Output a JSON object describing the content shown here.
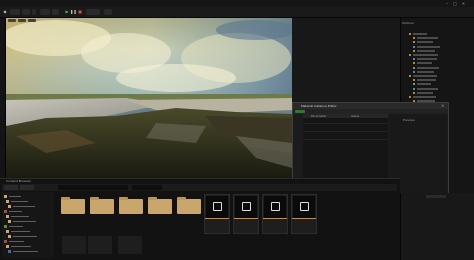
{
  "window": {
    "title": "",
    "controls": [
      "–",
      "□",
      "✕"
    ]
  },
  "toolbar": {
    "buttons": [
      "File",
      "Edit",
      "Window",
      "Tools",
      "Build",
      "Select"
    ],
    "platforms_label": "Platforms",
    "mode_label": "Selection Mode"
  },
  "material_window": {
    "title": "Material Instance Editor",
    "column_headers": [
      "Parameter",
      "Value"
    ],
    "preview_label": "Preview"
  },
  "outliner": {
    "header": "Outliner",
    "row_colors": [
      "#d8b64a",
      "#d8b64a",
      "#d8b64a",
      "#6fa8e0",
      "#d8b64a",
      "#d8b64a",
      "#6fa8e0",
      "#d8b64a",
      "#d8b64a",
      "#6fa8e0",
      "#d8b64a",
      "#d8b64a",
      "#d8b64a",
      "#6fa8e0",
      "#d8b64a",
      "#d8b64a",
      "#d8b64a",
      "#6fa8e0",
      "#d8b64a",
      "#d8b64a",
      "#d8b64a",
      "#d8b64a",
      "#6fa8e0",
      "#d8b64a"
    ]
  },
  "content_browser": {
    "header": "Content Browser",
    "add_label": "Add",
    "import_label": "Import",
    "folders": [
      "",
      "",
      "",
      "",
      ""
    ],
    "assets": [
      "",
      "",
      "",
      ""
    ],
    "status": ""
  },
  "colors": {
    "accent_orange": "#d68a2b",
    "folder": "#c9a66b",
    "play_green": "#4ec24e",
    "stop_red": "#d34a4a",
    "apply_green": "#2d7a2d"
  },
  "icons": {
    "play": "play-icon",
    "stop": "stop-icon",
    "texture": "texture-icon"
  }
}
